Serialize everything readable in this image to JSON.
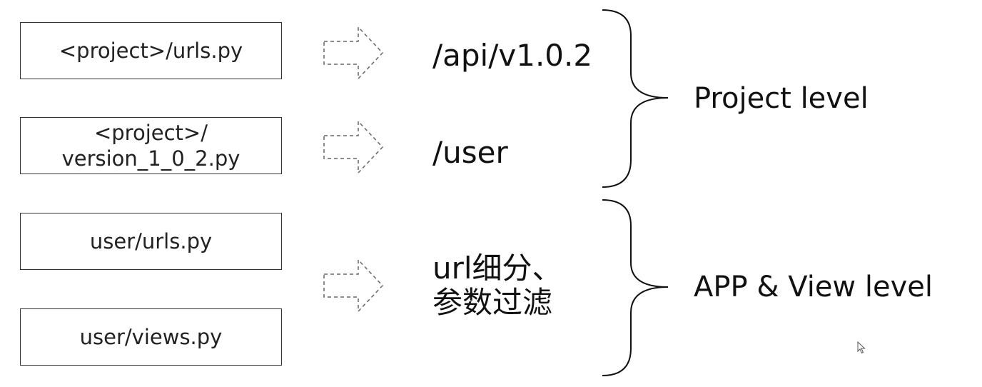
{
  "files": [
    {
      "lines": [
        "<project>/urls.py"
      ]
    },
    {
      "lines": [
        "<project>/",
        "version_1_0_2.py"
      ]
    },
    {
      "lines": [
        "user/urls.py"
      ]
    },
    {
      "lines": [
        "user/views.py"
      ]
    }
  ],
  "routes": [
    {
      "lines": [
        "/api/v1.0.2"
      ]
    },
    {
      "lines": [
        "/user"
      ]
    },
    {
      "lines": [
        "url细分、",
        "参数过滤"
      ]
    }
  ],
  "levels": [
    {
      "label": "Project level"
    },
    {
      "label": "APP & View level"
    }
  ],
  "icons": {
    "arrow": "dashed-right-arrow-icon",
    "brace": "right-curly-brace-icon",
    "cursor": "mouse-pointer-icon"
  },
  "colors": {
    "border": "#333333",
    "text": "#111111",
    "arrow_stroke": "#666666"
  }
}
